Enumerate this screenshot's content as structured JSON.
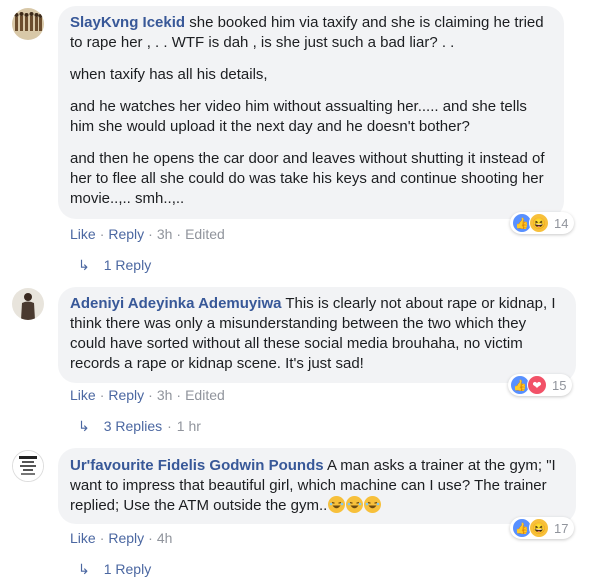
{
  "comments": [
    {
      "author": "SlayKvng Icekid",
      "paragraphs": [
        "she booked him via taxify and she is claiming he tried to rape her , . . WTF is dah , is she just such a bad liar? . .",
        "when taxify has all his details,",
        "and he watches her video him without assualting her..... and she tells him she would upload it the next day and he doesn't bother?",
        "and then he opens the car door and leaves without shutting it instead of her to flee all she could do was take his keys and continue shooting her movie..,.. smh..,.."
      ],
      "reactions": [
        "like",
        "haha"
      ],
      "reaction_count": "14",
      "like_label": "Like",
      "reply_label": "Reply",
      "time": "3h",
      "edited": "Edited",
      "replies_label": "1 Reply",
      "replies_time": ""
    },
    {
      "author": "Adeniyi Adeyinka Ademuyiwa",
      "paragraphs": [
        "This is clearly not about rape or kidnap, I think there was only a misunderstanding between the two which they could have sorted without all these social media brouhaha, no victim records a rape or kidnap scene. It's just sad!"
      ],
      "reactions": [
        "like",
        "love"
      ],
      "reaction_count": "15",
      "like_label": "Like",
      "reply_label": "Reply",
      "time": "3h",
      "edited": "Edited",
      "replies_label": "3 Replies",
      "replies_time": "1 hr"
    },
    {
      "author": "Ur'favourite Fidelis Godwin Pounds",
      "paragraphs": [
        "A man asks a trainer at the gym; \"I want to impress that beautiful girl, which machine can I use? The trainer replied; Use the ATM outside the gym.."
      ],
      "reactions": [
        "like",
        "haha"
      ],
      "reaction_count": "17",
      "like_label": "Like",
      "reply_label": "Reply",
      "time": "4h",
      "edited": "",
      "replies_label": "1 Reply",
      "replies_time": ""
    }
  ],
  "reply_arrow_icon": "reply-arrow-icon",
  "colors": {
    "name": "#385898",
    "link": "#4b67a1",
    "meta": "#90949c",
    "bubble": "#f2f3f5",
    "like": "#5890ff",
    "love": "#f25268",
    "haha": "#f7c03b"
  }
}
